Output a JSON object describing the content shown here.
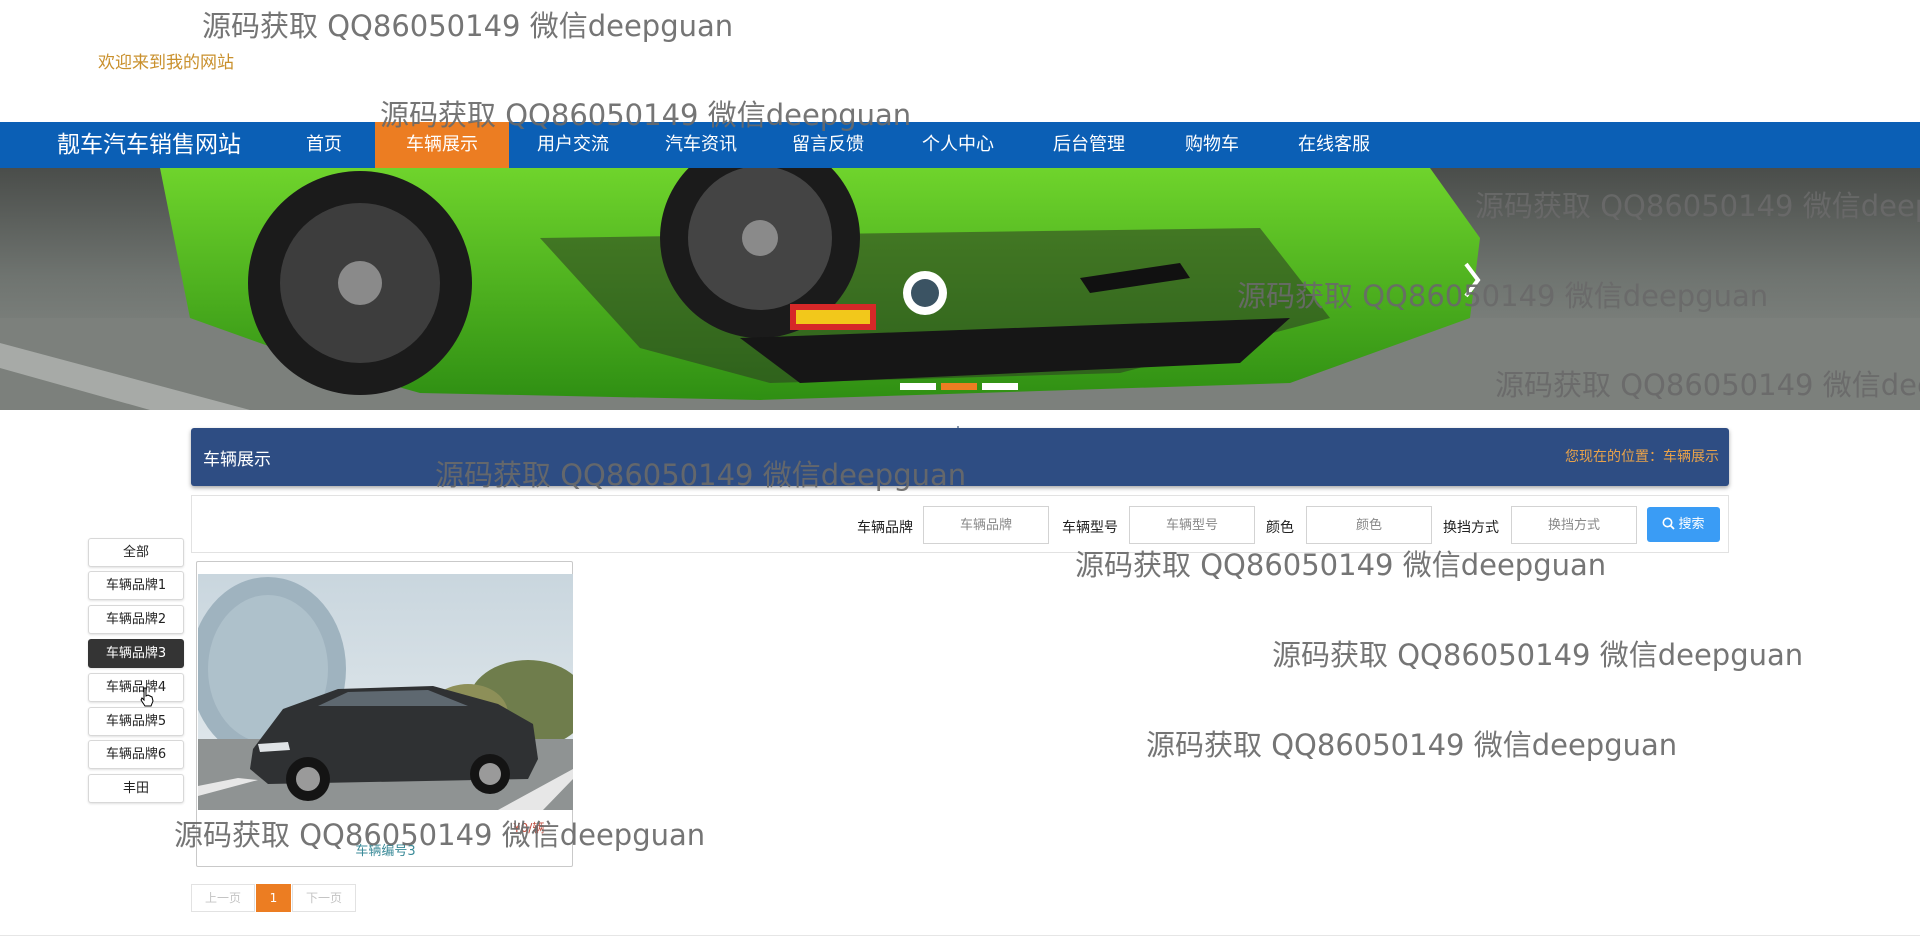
{
  "welcome_text": "欢迎来到我的网站",
  "nav": {
    "brand": "靓车汽车销售网站",
    "items": [
      {
        "label": "首页",
        "active": false
      },
      {
        "label": "车辆展示",
        "active": true
      },
      {
        "label": "用户交流",
        "active": false
      },
      {
        "label": "汽车资讯",
        "active": false
      },
      {
        "label": "留言反馈",
        "active": false
      },
      {
        "label": "个人中心",
        "active": false
      },
      {
        "label": "后台管理",
        "active": false
      },
      {
        "label": "购物车",
        "active": false
      },
      {
        "label": "在线客服",
        "active": false
      }
    ]
  },
  "banner": {
    "slide_count": 3,
    "active_slide_index": 1
  },
  "section": {
    "title": "车辆展示",
    "breadcrumb": "您现在的位置：车辆展示"
  },
  "search": {
    "fields": [
      {
        "label": "车辆品牌",
        "placeholder": "车辆品牌"
      },
      {
        "label": "车辆型号",
        "placeholder": "车辆型号"
      },
      {
        "label": "颜色",
        "placeholder": "颜色"
      },
      {
        "label": "换挡方式",
        "placeholder": "换挡方式"
      }
    ],
    "button_label": "搜索"
  },
  "sidebar": {
    "items": [
      {
        "label": "全部",
        "active": false
      },
      {
        "label": "车辆品牌1",
        "active": false
      },
      {
        "label": "车辆品牌2",
        "active": false
      },
      {
        "label": "车辆品牌3",
        "active": true
      },
      {
        "label": "车辆品牌4",
        "active": false
      },
      {
        "label": "车辆品牌5",
        "active": false
      },
      {
        "label": "车辆品牌6",
        "active": false
      },
      {
        "label": "丰田",
        "active": false
      }
    ]
  },
  "products": [
    {
      "name": "车辆编号3",
      "price_text": "¥0/辆"
    }
  ],
  "pagination": {
    "prev": "上一页",
    "current": "1",
    "next": "下一页"
  },
  "watermark_text": "源码获取 QQ86050149 微信deepguan",
  "colors": {
    "nav_bg": "#0b5fb5",
    "accent": "#ec7d22",
    "header_bg": "#2e4d83",
    "search_btn": "#3a9cf5"
  }
}
